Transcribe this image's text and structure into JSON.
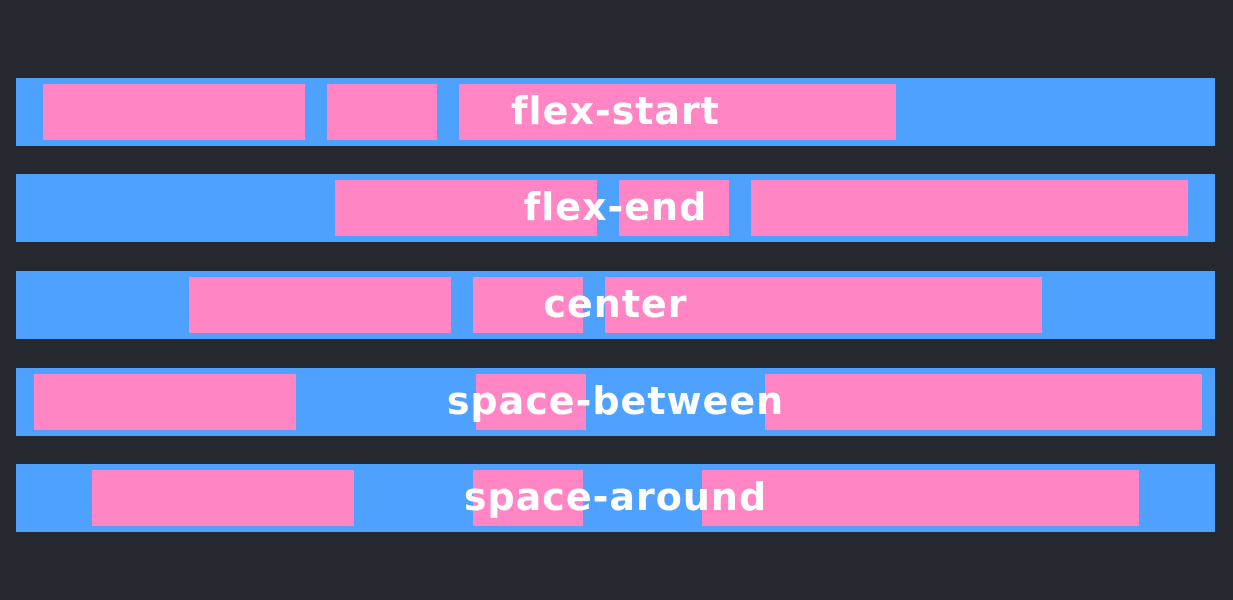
{
  "colors": {
    "background": "#25282f",
    "container": "#4fa1ff",
    "item": "#ff85c4",
    "label": "#ffffff"
  },
  "rows": [
    {
      "label": "flex-start",
      "justify": "flex-start"
    },
    {
      "label": "flex-end",
      "justify": "flex-end"
    },
    {
      "label": "center",
      "justify": "center"
    },
    {
      "label": "space-between",
      "justify": "space-between"
    },
    {
      "label": "space-around",
      "justify": "space-around"
    }
  ]
}
